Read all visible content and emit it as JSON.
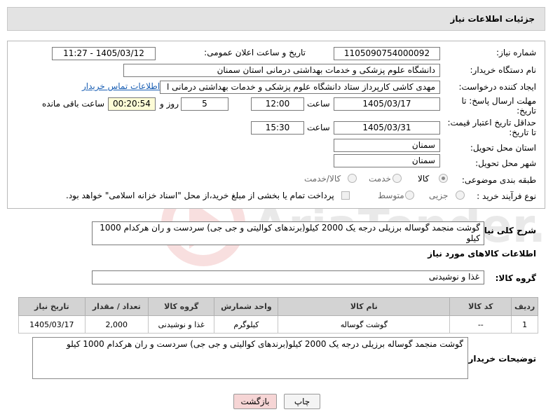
{
  "header": {
    "title": "جزئیات اطلاعات نیاز"
  },
  "form": {
    "need_number_label": "شماره نیاز:",
    "need_number": "1105090754000092",
    "announce_label": "تاریخ و ساعت اعلان عمومی:",
    "announce_value": "1405/03/12 - 11:27",
    "buyer_org_label": "نام دستگاه خریدار:",
    "buyer_org": "دانشگاه علوم پزشکی و خدمات بهداشتی  درمانی استان سمنان",
    "requester_label": "ایجاد کننده درخواست:",
    "requester": "مهدی کاشی کارپرداز ستاد دانشگاه علوم پزشکی و خدمات بهداشتی  درمانی ا",
    "contact_link": "اطلاعات تماس خریدار",
    "deadline_label_1": "مهلت ارسال پاسخ: تا",
    "deadline_label_2": "تاریخ:",
    "deadline_date": "1405/03/17",
    "hour_label": "ساعت",
    "deadline_time": "12:00",
    "days_value": "5",
    "days_label": "روز و",
    "remaining_time": "00:20:54",
    "remaining_label": "ساعت باقی مانده",
    "validity_label_1": "حداقل تاریخ اعتبار قیمت:",
    "validity_label_2": "تا تاریخ:",
    "validity_date": "1405/03/31",
    "validity_hour_label": "ساعت",
    "validity_time": "15:30",
    "province_label": "استان محل تحویل:",
    "province": "سمنان",
    "city_label": "شهر محل تحویل:",
    "city": "سمنان",
    "category_label": "طبقه بندی موضوعی:",
    "category_options": [
      "کالا",
      "خدمت",
      "کالا/خدمت"
    ],
    "category_selected": "کالا",
    "process_label": "نوع فرآیند خرید :",
    "process_options": [
      "جزیی",
      "متوسط"
    ],
    "payment_note": "پرداخت تمام یا بخشی از مبلغ خرید،از محل \"اسناد خزانه اسلامی\" خواهد بود."
  },
  "description": {
    "label": "شرح کلی نیاز:",
    "text": "گوشت منجمد گوساله برزیلی درجه یک 2000 کیلو(برندهای کوالیتی و جی جی) سردست و ران هرکدام 1000 کیلو"
  },
  "goods": {
    "section_title": "اطلاعات کالاهای مورد نیاز",
    "group_label": "گروه کالا:",
    "group_value": "غذا و نوشیدنی",
    "columns": [
      "ردیف",
      "کد کالا",
      "نام کالا",
      "واحد شمارش",
      "گروه کالا",
      "تعداد / مقدار",
      "تاریخ نیاز"
    ],
    "rows": [
      {
        "row": "1",
        "code": "--",
        "name": "گوشت گوساله",
        "unit": "کیلوگرم",
        "group": "غذا و نوشیدنی",
        "qty": "2,000",
        "date": "1405/03/17"
      }
    ]
  },
  "buyer_notes": {
    "label": "توضیحات خریدار:",
    "text": "گوشت منجمد گوساله برزیلی درجه یک 2000 کیلو(برندهای کوالیتی و جی جی) سردست و ران هرکدام 1000 کیلو"
  },
  "buttons": {
    "print": "چاپ",
    "back": "بازگشت"
  },
  "watermark_text": "AriaTender.net",
  "colors": {
    "link": "#1a5fb4",
    "header_bg": "#e3e3e3",
    "table_header_bg": "#d3d3d3",
    "back_button": "#f6d5d5",
    "remaining_bg": "#fdfcd6"
  }
}
